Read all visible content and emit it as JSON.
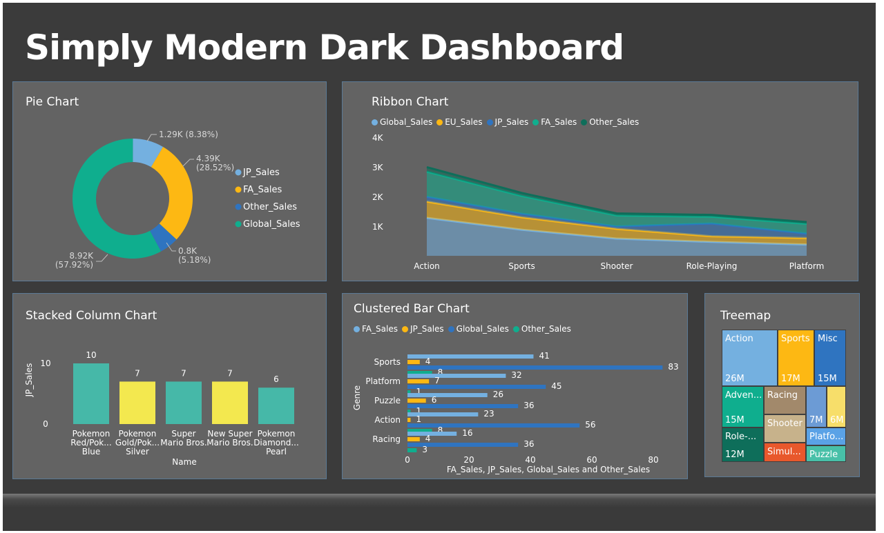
{
  "dashboard": {
    "title": "Simply Modern Dark Dashboard"
  },
  "colors": {
    "jp": "#74b0e0",
    "fa": "#fdb813",
    "other": "#2f74c0",
    "global": "#0fae8e",
    "yellow": "#f3e84f",
    "teal": "#46b8a8",
    "background": "#3b3b3b",
    "panel": "#636363"
  },
  "pie": {
    "title": "Pie Chart",
    "chart_data": {
      "type": "pie",
      "donut": true,
      "slices": [
        {
          "name": "JP_Sales",
          "label": "1.29K (8.38%)",
          "value": 1290,
          "percent": 8.38,
          "color": "#74b0e0"
        },
        {
          "name": "FA_Sales",
          "label_value": "4.39K",
          "label_pct": "(28.52%)",
          "value": 4390,
          "percent": 28.52,
          "color": "#fdb813"
        },
        {
          "name": "Other_Sales",
          "label_value": "0.8K",
          "label_pct": "(5.18%)",
          "value": 800,
          "percent": 5.18,
          "color": "#2f74c0"
        },
        {
          "name": "Global_Sales",
          "label_value": "8.92K",
          "label_pct": "(57.92%)",
          "value": 8920,
          "percent": 57.92,
          "color": "#0fae8e"
        }
      ],
      "legend": [
        "JP_Sales",
        "FA_Sales",
        "Other_Sales",
        "Global_Sales"
      ],
      "legend_position": "right"
    }
  },
  "ribbon": {
    "title": "Ribbon Chart",
    "chart_data": {
      "type": "area",
      "stacked": true,
      "categories": [
        "Action",
        "Sports",
        "Shooter",
        "Role-Playing",
        "Platform"
      ],
      "yticks": [
        "1K",
        "2K",
        "3K",
        "4K"
      ],
      "ylim": [
        0,
        4000
      ],
      "series": [
        {
          "name": "Global_Sales",
          "values": [
            1280,
            880,
            580,
            470,
            380
          ],
          "color": "#74b0e0"
        },
        {
          "name": "EU_Sales",
          "values": [
            550,
            420,
            330,
            190,
            220
          ],
          "color": "#fdb813"
        },
        {
          "name": "JP_Sales",
          "values": [
            160,
            120,
            80,
            430,
            150
          ],
          "color": "#2f74c0"
        },
        {
          "name": "FA_Sales",
          "values": [
            850,
            600,
            370,
            230,
            330
          ],
          "color": "#0fae8e"
        },
        {
          "name": "Other_Sales",
          "values": [
            150,
            100,
            70,
            60,
            60
          ],
          "color": "#0e6e5a"
        }
      ],
      "legend_position": "top-left"
    }
  },
  "stacked": {
    "title": "Stacked Column Chart",
    "chart_data": {
      "type": "bar",
      "categories": [
        [
          "Pokemon",
          "Red/Pok...",
          "Blue"
        ],
        [
          "Pokemon",
          "Gold/Pok...",
          "Silver"
        ],
        [
          "Super",
          "Mario Bros."
        ],
        [
          "New Super",
          "Mario Bros."
        ],
        [
          "Pokemon",
          "Diamond...",
          "Pearl"
        ]
      ],
      "values": [
        10,
        7,
        7,
        7,
        6
      ],
      "colors": [
        "#46b8a8",
        "#f3e84f",
        "#46b8a8",
        "#f3e84f",
        "#46b8a8"
      ],
      "xlabel": "Name",
      "ylabel": "JP_Sales",
      "yticks": [
        "0",
        "10"
      ],
      "ylim": [
        0,
        11
      ]
    }
  },
  "clustered": {
    "title": "Clustered Bar Chart",
    "chart_data": {
      "type": "bar",
      "orientation": "horizontal",
      "categories": [
        "Sports",
        "Platform",
        "Puzzle",
        "Action",
        "Racing"
      ],
      "series": [
        {
          "name": "FA_Sales",
          "values": [
            41,
            32,
            26,
            23,
            16
          ],
          "color": "#74b0e0"
        },
        {
          "name": "JP_Sales",
          "values": [
            4,
            7,
            6,
            1,
            4
          ],
          "color": "#fdb813"
        },
        {
          "name": "Global_Sales",
          "values": [
            83,
            45,
            36,
            56,
            36
          ],
          "color": "#2f74c0"
        },
        {
          "name": "Other_Sales",
          "values": [
            8,
            1,
            1,
            8,
            3
          ],
          "color": "#0fae8e"
        }
      ],
      "xticks": [
        "0",
        "20",
        "40",
        "60",
        "80"
      ],
      "xlim": [
        0,
        87
      ],
      "xlabel": "FA_Sales, JP_Sales, Global_Sales and Other_Sales",
      "ylabel": "Genre",
      "legend_position": "top-left"
    }
  },
  "treemap": {
    "title": "Treemap",
    "cells": [
      {
        "label": "Action",
        "value": "26M",
        "color": "#74b0e0"
      },
      {
        "label": "Sports",
        "value": "17M",
        "color": "#fdb813"
      },
      {
        "label": "Misc",
        "value": "15M",
        "color": "#2f74c0"
      },
      {
        "label": "Adven...",
        "value": "15M",
        "color": "#0fae8e"
      },
      {
        "label": "Role-...",
        "value": "12M",
        "color": "#0e6e5a"
      },
      {
        "label": "Racing",
        "value": "",
        "color": "#a2896b"
      },
      {
        "label": "Shooter",
        "value": "",
        "color": "#c7b28b"
      },
      {
        "label": "",
        "value": "7M",
        "color": "#6c9bd5"
      },
      {
        "label": "",
        "value": "6M",
        "color": "#f7de6a"
      },
      {
        "label": "Platfo...",
        "value": "",
        "color": "#5aa2e6"
      },
      {
        "label": "Simul...",
        "value": "",
        "color": "#e8582c"
      },
      {
        "label": "Puzzle",
        "value": "",
        "color": "#48c0a8"
      }
    ]
  }
}
